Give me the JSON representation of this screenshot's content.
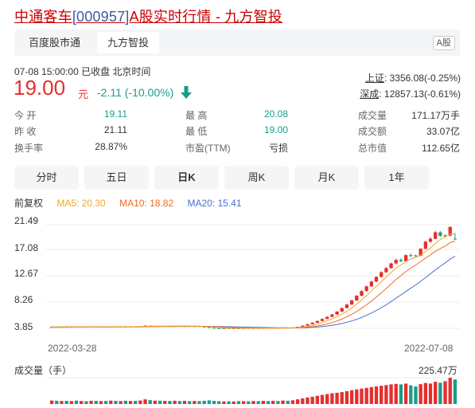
{
  "header": {
    "name": "中通客车",
    "code": "[000957]",
    "suffix": "A股实时行情 - 九方智投"
  },
  "tabs": [
    {
      "label": "百度股市通"
    },
    {
      "label": "九方智投"
    }
  ],
  "market_tag": "A股",
  "quote": {
    "time": "07-08 15:00:00  已收盘  北京时间",
    "price": "19.00",
    "unit": "元",
    "change": "-2.11 (-10.00%)"
  },
  "indices": [
    {
      "name": "上证",
      "value": ": 3356.08(-0.25%)"
    },
    {
      "name": "深成",
      "value": ": 12857.13(-0.61%)"
    }
  ],
  "stats": {
    "open": {
      "label": "今  开",
      "value": "19.11"
    },
    "high": {
      "label": "最  高",
      "value": "20.08"
    },
    "volume": {
      "label": "成交量",
      "value": "171.17万手"
    },
    "prev_close": {
      "label": "昨  收",
      "value": "21.11"
    },
    "low": {
      "label": "最  低",
      "value": "19.00"
    },
    "turnover_amount": {
      "label": "成交额",
      "value": "33.07亿"
    },
    "turnover_rate": {
      "label": "换手率",
      "value": "28.87%"
    },
    "pe": {
      "label": "市盈(TTM)",
      "value": "亏损"
    },
    "market_cap": {
      "label": "总市值",
      "value": "112.65亿"
    }
  },
  "periods": [
    "分时",
    "五日",
    "日K",
    "周K",
    "月K",
    "1年"
  ],
  "active_period": "日K",
  "legend": {
    "adjust": "前复权",
    "ma5": "MA5: 20.30",
    "ma10": "MA10: 18.82",
    "ma20": "MA20: 15.41"
  },
  "colors": {
    "up": "#e62e2e",
    "down": "#1a9c8a",
    "ma5": "#f5a623",
    "ma10": "#f36c21",
    "ma20": "#4a6fd4"
  },
  "chart_data": {
    "type": "candlestick",
    "y_ticks": [
      "21.49",
      "17.08",
      "12.67",
      "8.26",
      "3.85"
    ],
    "ylim": [
      3.85,
      21.49
    ],
    "x_labels": [
      "2022-03-28",
      "2022-07-08"
    ],
    "candles": [
      [
        4.05,
        4.08,
        4.0,
        4.1
      ],
      [
        4.08,
        4.06,
        4.03,
        4.11
      ],
      [
        4.06,
        4.09,
        4.04,
        4.12
      ],
      [
        4.09,
        4.07,
        4.04,
        4.12
      ],
      [
        4.07,
        4.1,
        4.05,
        4.13
      ],
      [
        4.1,
        4.08,
        4.06,
        4.13
      ],
      [
        4.08,
        4.11,
        4.06,
        4.14
      ],
      [
        4.11,
        4.09,
        4.07,
        4.14
      ],
      [
        4.09,
        4.12,
        4.07,
        4.15
      ],
      [
        4.12,
        4.1,
        4.08,
        4.15
      ],
      [
        4.1,
        4.13,
        4.08,
        4.16
      ],
      [
        4.13,
        4.11,
        4.09,
        4.16
      ],
      [
        4.11,
        4.14,
        4.09,
        4.17
      ],
      [
        4.14,
        4.12,
        4.1,
        4.17
      ],
      [
        4.12,
        4.15,
        4.1,
        4.18
      ],
      [
        4.15,
        4.13,
        4.11,
        4.18
      ],
      [
        4.13,
        4.16,
        4.11,
        4.19
      ],
      [
        4.16,
        4.14,
        4.12,
        4.19
      ],
      [
        4.14,
        4.17,
        4.12,
        4.22
      ],
      [
        4.17,
        4.3,
        4.15,
        4.4
      ],
      [
        4.3,
        4.22,
        4.18,
        4.34
      ],
      [
        4.22,
        4.25,
        4.18,
        4.28
      ],
      [
        4.25,
        4.21,
        4.17,
        4.28
      ],
      [
        4.21,
        4.26,
        4.19,
        4.3
      ],
      [
        4.26,
        4.2,
        4.16,
        4.29
      ],
      [
        4.2,
        4.24,
        4.17,
        4.27
      ],
      [
        4.24,
        4.19,
        4.15,
        4.26
      ],
      [
        4.19,
        4.23,
        4.16,
        4.26
      ],
      [
        4.23,
        4.18,
        4.14,
        4.25
      ],
      [
        4.18,
        4.22,
        4.15,
        4.25
      ],
      [
        4.22,
        4.15,
        4.1,
        4.24
      ],
      [
        4.15,
        4.05,
        3.98,
        4.17
      ],
      [
        4.05,
        3.95,
        3.9,
        4.08
      ],
      [
        3.95,
        3.88,
        3.82,
        3.99
      ],
      [
        3.88,
        3.85,
        3.8,
        3.92
      ],
      [
        3.85,
        3.88,
        3.82,
        3.91
      ],
      [
        3.88,
        3.84,
        3.8,
        3.9
      ],
      [
        3.84,
        3.87,
        3.81,
        3.9
      ],
      [
        3.87,
        3.85,
        3.82,
        3.9
      ],
      [
        3.85,
        3.89,
        3.83,
        3.92
      ],
      [
        3.89,
        3.86,
        3.83,
        3.92
      ],
      [
        3.86,
        3.9,
        3.84,
        3.93
      ],
      [
        3.9,
        3.88,
        3.85,
        3.93
      ],
      [
        3.88,
        3.92,
        3.86,
        3.95
      ],
      [
        3.92,
        3.9,
        3.87,
        3.95
      ],
      [
        3.9,
        3.94,
        3.88,
        3.97
      ],
      [
        3.94,
        3.92,
        3.89,
        3.97
      ],
      [
        3.92,
        3.96,
        3.9,
        3.99
      ],
      [
        3.96,
        3.94,
        3.91,
        3.99
      ],
      [
        3.94,
        3.98,
        3.92,
        4.01
      ],
      [
        3.98,
        4.1,
        3.96,
        4.15
      ],
      [
        4.1,
        4.3,
        4.08,
        4.36
      ],
      [
        4.3,
        4.55,
        4.26,
        4.62
      ],
      [
        4.55,
        4.8,
        4.5,
        4.88
      ],
      [
        4.8,
        5.1,
        4.75,
        5.18
      ],
      [
        5.1,
        5.45,
        5.05,
        5.52
      ],
      [
        5.45,
        5.8,
        5.4,
        5.9
      ],
      [
        5.8,
        6.2,
        5.74,
        6.3
      ],
      [
        6.2,
        6.7,
        6.15,
        6.78
      ],
      [
        6.7,
        7.3,
        6.62,
        7.38
      ],
      [
        7.3,
        7.9,
        7.22,
        8.0
      ],
      [
        7.9,
        8.6,
        7.82,
        8.7
      ],
      [
        8.6,
        9.4,
        8.52,
        9.5
      ],
      [
        9.4,
        10.2,
        9.3,
        10.32
      ],
      [
        10.2,
        11.0,
        10.1,
        11.12
      ],
      [
        11.0,
        11.8,
        10.9,
        11.95
      ],
      [
        11.8,
        12.6,
        11.7,
        12.75
      ],
      [
        12.6,
        13.4,
        12.5,
        13.55
      ],
      [
        13.4,
        14.1,
        13.3,
        14.3
      ],
      [
        14.1,
        14.9,
        14.0,
        15.05
      ],
      [
        14.9,
        15.5,
        14.8,
        15.7
      ],
      [
        15.5,
        15.3,
        15.1,
        15.8
      ],
      [
        15.3,
        16.3,
        15.2,
        16.45
      ],
      [
        16.3,
        16.25,
        16.0,
        16.6
      ],
      [
        16.25,
        16.2,
        16.05,
        16.4
      ],
      [
        16.2,
        17.4,
        16.1,
        17.5
      ],
      [
        17.4,
        18.6,
        17.3,
        18.75
      ],
      [
        18.6,
        19.1,
        18.4,
        19.4
      ],
      [
        19.1,
        20.2,
        19.0,
        20.45
      ],
      [
        20.2,
        19.6,
        19.4,
        20.4
      ],
      [
        19.6,
        19.65,
        19.3,
        19.9
      ],
      [
        19.65,
        21.11,
        19.5,
        21.2
      ],
      [
        19.11,
        19.0,
        18.9,
        20.08
      ]
    ],
    "ma5_end": 20.3,
    "ma10_end": 18.82,
    "ma20_end": 15.41,
    "volume_title": "成交量（手）",
    "volume_max_label": "225.47万",
    "volume_max": 2254700,
    "volumes": [
      30,
      28,
      26,
      27,
      25,
      29,
      26,
      24,
      28,
      27,
      25,
      26,
      29,
      27,
      25,
      28,
      26,
      27,
      30,
      40,
      33,
      29,
      28,
      27,
      26,
      28,
      25,
      27,
      24,
      26,
      25,
      28,
      31,
      27,
      24,
      22,
      23,
      22,
      25,
      24,
      23,
      26,
      24,
      27,
      25,
      28,
      26,
      30,
      28,
      32,
      40,
      48,
      56,
      62,
      70,
      78,
      85,
      92,
      96,
      102,
      110,
      118,
      125,
      132,
      138,
      145,
      150,
      156,
      162,
      168,
      172,
      168,
      175,
      160,
      150,
      170,
      180,
      175,
      190,
      182,
      195,
      225,
      210
    ]
  }
}
